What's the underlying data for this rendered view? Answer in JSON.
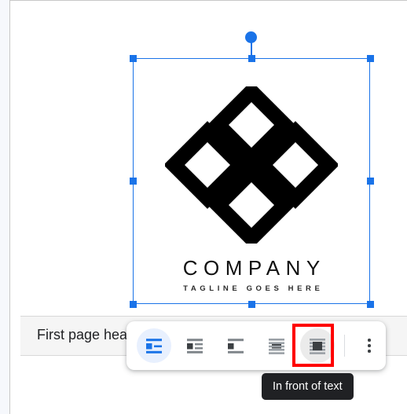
{
  "document": {
    "header_text": "First page hea",
    "page_background": "#ffffff",
    "app_background": "#f6f8fc",
    "header_band_background": "#f5f5f5"
  },
  "image": {
    "alt_name": "company-logo-image",
    "wordmark": "COMPANY",
    "tagline": "TAGLINE GOES HERE",
    "artwork_icon": "four-diamond-logo-icon",
    "selected": true,
    "selection_color": "#1a73e8",
    "handles": [
      "top-left",
      "top-center",
      "top-right",
      "middle-left",
      "middle-right",
      "bottom-left",
      "bottom-center",
      "bottom-right"
    ],
    "rotate_handle": "rotate-handle"
  },
  "toolbar": {
    "name": "image-layout-toolbar",
    "active_option_index": 0,
    "hovered_option_index": 4,
    "highlighted_option_index": 4,
    "highlight_color": "#fe0000",
    "active_background": "#e8f0fe",
    "active_icon_color": "#1a73e8",
    "icon_color": "#5f6368",
    "options": [
      {
        "id": "in-line",
        "label": "In line",
        "icon": "layout-in-line-icon"
      },
      {
        "id": "wrap-text",
        "label": "Wrap text",
        "icon": "layout-wrap-text-icon"
      },
      {
        "id": "break-text",
        "label": "Break text",
        "icon": "layout-break-text-icon"
      },
      {
        "id": "behind-text",
        "label": "Behind text",
        "icon": "layout-behind-text-icon"
      },
      {
        "id": "in-front-of-text",
        "label": "In front of text",
        "icon": "layout-in-front-of-text-icon"
      }
    ],
    "more_options_label": "More image options",
    "more_options_icon": "three-dot-menu-icon"
  },
  "tooltip": {
    "text": "In front of text",
    "background": "#202124"
  }
}
